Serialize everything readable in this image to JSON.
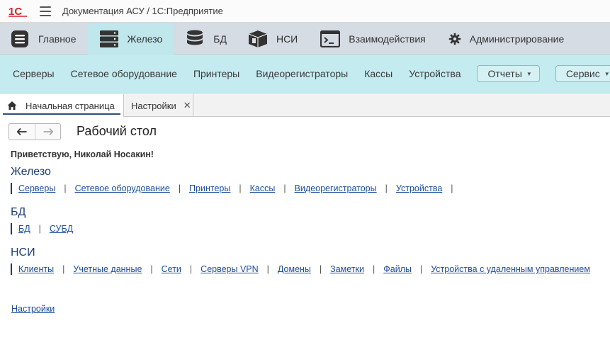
{
  "titlebar": {
    "logo": "1C",
    "title": "Документация АСУ /  1С:Предприятие"
  },
  "sections": [
    {
      "label": "Главное",
      "icon": "hamburger-icon",
      "active": false
    },
    {
      "label": "Железо",
      "icon": "server-icon",
      "active": true
    },
    {
      "label": "БД",
      "icon": "database-icon",
      "active": false
    },
    {
      "label": "НСИ",
      "icon": "box-icon",
      "active": false
    },
    {
      "label": "Взаимодействия",
      "icon": "terminal-icon",
      "active": false
    },
    {
      "label": "Администрирование",
      "icon": "gear-icon",
      "active": false
    }
  ],
  "commands": {
    "items": [
      "Серверы",
      "Сетевое оборудование",
      "Принтеры",
      "Видеорегистраторы",
      "Кассы",
      "Устройства"
    ],
    "reports_label": "Отчеты",
    "service_label": "Сервис"
  },
  "tabs": [
    {
      "label": "Начальная страница",
      "active": true
    },
    {
      "label": "Настройки",
      "active": false
    }
  ],
  "content": {
    "page_title": "Рабочий стол",
    "greeting": "Приветствую, Николай Носакин!",
    "groups": [
      {
        "title": "Железо",
        "links": [
          "Серверы",
          "Сетевое оборудование",
          "Принтеры",
          "Кассы",
          "Видеорегистраторы",
          "Устройства"
        ],
        "trailing_sep": true
      },
      {
        "title": "БД",
        "links": [
          "БД",
          "СУБД"
        ],
        "trailing_sep": false
      },
      {
        "title": "НСИ",
        "links": [
          "Клиенты",
          "Учетные данные",
          "Сети",
          "Серверы VPN",
          "Домены",
          "Заметки",
          "Файлы",
          "Устройства с удаленным управлением"
        ],
        "trailing_sep": false
      }
    ],
    "settings_link": "Настройки"
  },
  "colors": {
    "sections_bg": "#d5dce4",
    "active_section_bg": "#bfe7ec",
    "commands_bg": "#c4ebef",
    "link": "#1d4e9c",
    "group_title": "#1d3c78",
    "logo_red": "#d6252a"
  }
}
